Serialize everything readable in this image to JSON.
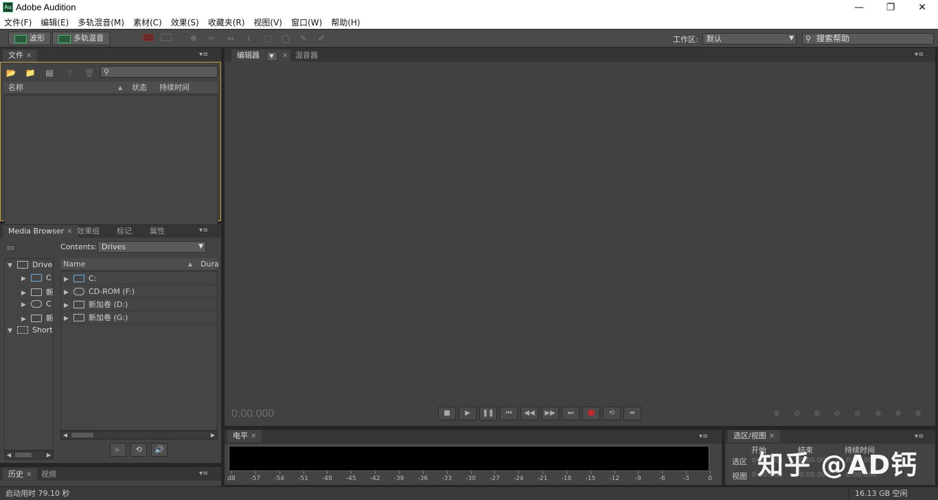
{
  "window": {
    "title": "Adobe Audition",
    "app_icon_label": "Au",
    "minimize_glyph": "—",
    "restore_glyph": "❐",
    "close_glyph": "✕"
  },
  "menubar": {
    "items": [
      "文件(F)",
      "编辑(E)",
      "多轨混音(M)",
      "素材(C)",
      "效果(S)",
      "收藏夹(R)",
      "视图(V)",
      "窗口(W)",
      "帮助(H)"
    ]
  },
  "toolbar": {
    "waveform_label": "波形",
    "multitrack_label": "多轨混音",
    "workspace_label": "工作区:",
    "workspace_value": "默认",
    "search_help_placeholder": "搜索帮助"
  },
  "files_panel": {
    "tab_label": "文件",
    "columns": [
      "名称",
      "状态",
      "持续时间"
    ]
  },
  "media_browser": {
    "tabs": [
      "Media Browser",
      "效果组",
      "标记",
      "属性"
    ],
    "contents_label": "Contents:",
    "contents_value": "Drives",
    "tree": [
      {
        "label": "Drives",
        "expanded": true
      },
      {
        "label": "C"
      },
      {
        "label": "新"
      },
      {
        "label": "C"
      },
      {
        "label": "新"
      },
      {
        "label": "Shorto",
        "expanded": true
      }
    ],
    "columns": [
      "Name",
      "Dura"
    ],
    "drives": [
      {
        "name": "C:"
      },
      {
        "name": "CD-ROM (F:)"
      },
      {
        "name": "新加卷 (D:)"
      },
      {
        "name": "新加卷 (G:)"
      }
    ]
  },
  "history_panel": {
    "tabs": [
      "历史",
      "视频"
    ]
  },
  "editor": {
    "tabs": [
      "编辑器",
      "混音器"
    ],
    "timecode": "0:00.000"
  },
  "level_meter": {
    "tab_label": "电平",
    "ticks": [
      "dB",
      "-57",
      "-54",
      "-51",
      "-48",
      "-45",
      "-42",
      "-39",
      "-36",
      "-33",
      "-30",
      "-27",
      "-24",
      "-21",
      "-18",
      "-15",
      "-12",
      "-9",
      "-6",
      "-3",
      "0"
    ]
  },
  "selection_view": {
    "tab_label": "选区/视图",
    "columns": [
      "开始",
      "结束",
      "持续时间"
    ],
    "rows": [
      {
        "label": "选区",
        "start": "0:00.000",
        "end": "0:00.000",
        "duration": "0:00.000"
      },
      {
        "label": "视图",
        "start": "0:00.000",
        "end": "0:00.000",
        "duration": "0:00.000"
      }
    ]
  },
  "status": {
    "startup_time": "启动用时 79.10 秒",
    "free_space": "16.13 GB 空闲"
  },
  "watermark": "知乎 @AD钙",
  "colors": {
    "record": "#c0282f",
    "accent_green": "#3fbf6f",
    "panel_focus": "#c8a040"
  }
}
